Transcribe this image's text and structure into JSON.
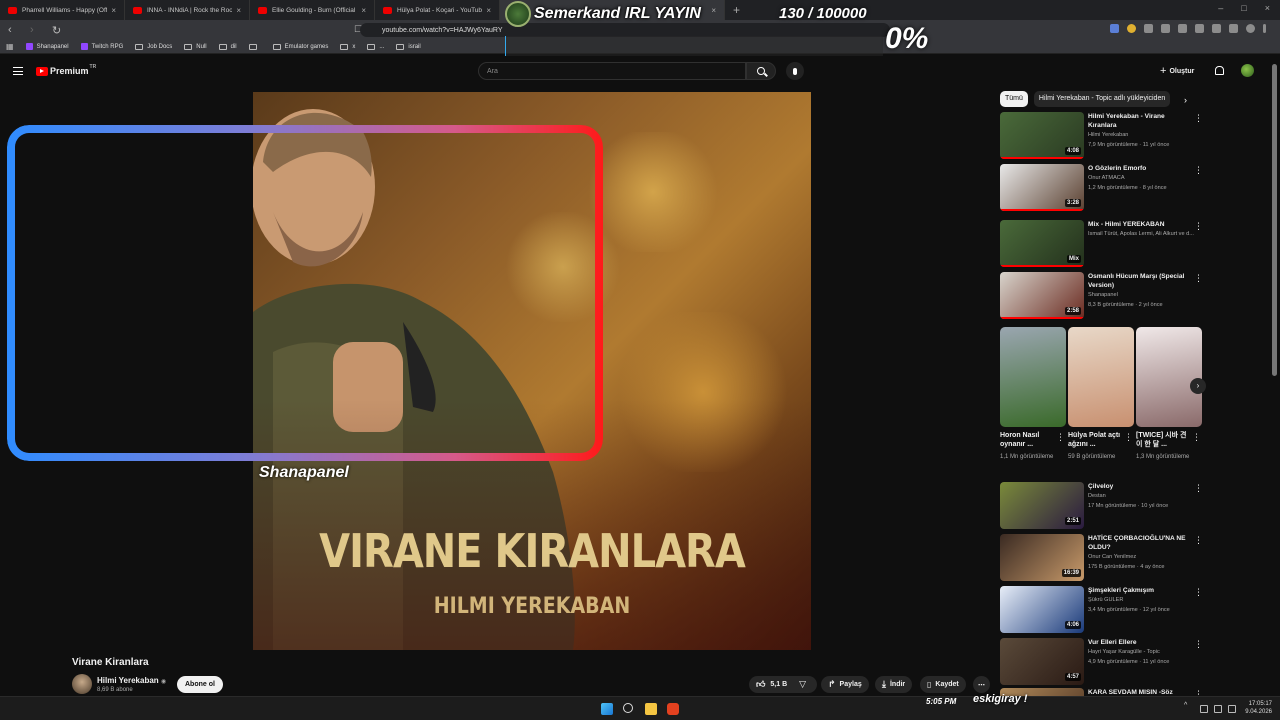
{
  "browser": {
    "tabs": [
      {
        "title": "Pharrell Williams - Happy (Official Vi",
        "active": false
      },
      {
        "title": "INNA - INNdiA | Rock the Roof @ Is",
        "active": false
      },
      {
        "title": "Ellie Goulding - Burn (Official Video)",
        "active": false
      },
      {
        "title": "Hülya Polat - Koçari - YouTube",
        "active": false
      },
      {
        "title": "",
        "active": false
      },
      {
        "title": "ube",
        "active": true
      }
    ],
    "url": "youtube.com/watch?v=HAJWy6YauRY",
    "bookmarks": [
      "Shanapanel",
      "Twitch RPG",
      "Job Docs",
      "Null",
      "dil",
      "",
      "Emulator games",
      "x",
      "...",
      "israil"
    ]
  },
  "youtube": {
    "logo_text": "Premium",
    "logo_region": "TR",
    "search_placeholder": "Ara",
    "create_label": "Oluştur",
    "video": {
      "title": "Virane Kiranlara",
      "album_title": "VIRANE KIRANLARA",
      "album_artist": "HILMI YEREKABAN",
      "channel": "Hilmi Yerekaban",
      "subscribers": "8,69 B abone",
      "subscribe_label": "Abone ol",
      "likes": "5,1 B",
      "share_label": "Paylaş",
      "download_label": "İndir",
      "save_label": "Kaydet"
    },
    "chips": [
      "Tümü",
      "Hilmi Yerekaban - Topic adlı yükleyiciden"
    ],
    "recommendations": [
      {
        "title": "Hilmi Yerekaban - Virane Kıranlara",
        "channel": "Hilmi Yerekaban",
        "meta": "7,9 Mn görüntüleme · 11 yıl önce",
        "duration": "4:08",
        "colors": [
          "#4a6a3a",
          "#2a3a22"
        ]
      },
      {
        "title": "O Gözlerin Emorfo",
        "channel": "Onur ATMACA",
        "meta": "1,2 Mn görüntüleme · 8 yıl önce",
        "duration": "3:28",
        "colors": [
          "#e8e8e8",
          "#5a4030"
        ]
      },
      {
        "title": "Mix - Hilmi YEREKABAN",
        "channel": "İsmail Türüt, Apolas Lermi, Ali Alkurt ve d...",
        "meta": "",
        "duration": "Mix",
        "colors": [
          "#4a6a3a",
          "#23301c"
        ]
      },
      {
        "title": "Osmanlı Hücum Marşı (Special Version)",
        "channel": "Shanapanel",
        "meta": "8,3 B görüntüleme · 2 yıl önce",
        "duration": "2:58",
        "colors": [
          "#d8d4cc",
          "#6a2a20"
        ]
      },
      {
        "title": "Çilveloy",
        "channel": "Destan",
        "meta": "17 Mn görüntüleme · 10 yıl önce",
        "duration": "2:51",
        "colors": [
          "#7a8a3a",
          "#2a1a40"
        ]
      },
      {
        "title": "HATİCE ÇORBACIOĞLU'NA NE OLDU?",
        "channel": "Onur Can Yenilmez",
        "meta": "175 B görüntüleme · 4 ay önce",
        "duration": "16:39",
        "colors": [
          "#3a2a22",
          "#c89a6a"
        ]
      },
      {
        "title": "Şimşekleri Çakmışım",
        "channel": "Şükrü GÜLER",
        "meta": "3,4 Mn görüntüleme · 12 yıl önce",
        "duration": "4:06",
        "colors": [
          "#e8eef8",
          "#1a3a7a"
        ]
      },
      {
        "title": "Vur Elleri Ellere",
        "channel": "Hayri Yaşar Karagülle - Topic",
        "meta": "4,9 Mn görüntüleme · 11 yıl önce",
        "duration": "4:57",
        "colors": [
          "#5a4a3a",
          "#2a1a14"
        ]
      },
      {
        "title": "KARA SEVDAM MISIN -Söz",
        "channel": "",
        "meta": "",
        "duration": "",
        "colors": [
          "#b08a5a",
          "#4a3020"
        ]
      }
    ],
    "shorts": [
      {
        "title": "Horon Nasıl oynanır ...",
        "meta": "1,1 Mn görüntüleme",
        "colors": [
          "#9aa6b0",
          "#3a6a2a"
        ]
      },
      {
        "title": "Hülya Polat açtı ağzını ...",
        "meta": "59 B görüntüleme",
        "colors": [
          "#e8d8c8",
          "#c89070"
        ]
      },
      {
        "title": "[TWICE] 시바 견이 한 달 ...",
        "meta": "1,3 Mn görüntüleme",
        "colors": [
          "#f0e8e8",
          "#8a6a6a"
        ]
      }
    ]
  },
  "overlay": {
    "stream_title": "Semerkand IRL YAYIN",
    "counter": "130 / 100000",
    "percent": "0%",
    "label": "Shanapanel",
    "time": "5:05 PM",
    "username": "eskigiray !"
  },
  "taskbar": {
    "clock_time": "17:05:17",
    "clock_date": "9.04.2026"
  },
  "colors": {
    "youtube_red": "#ff0000",
    "frame_gradient_start": "#2f8cff",
    "frame_gradient_end": "#ff1a1a",
    "background": "#0f0f0f"
  }
}
